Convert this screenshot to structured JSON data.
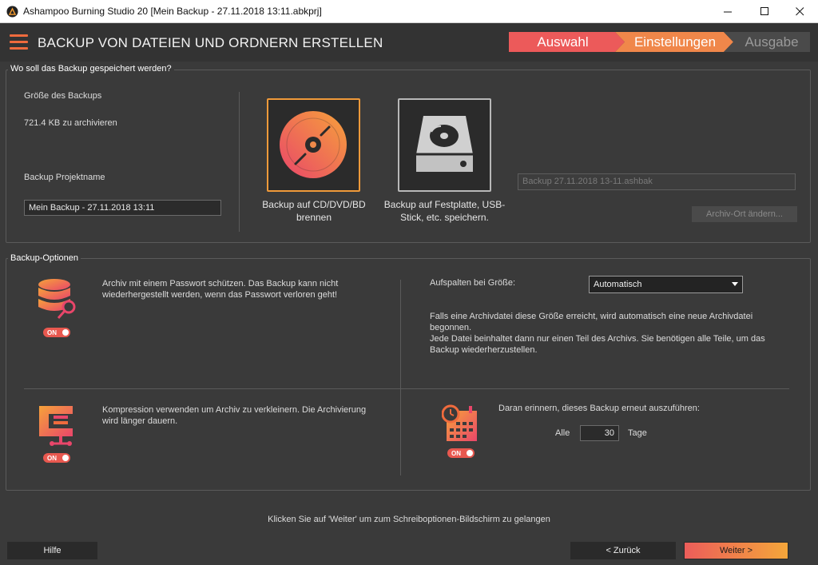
{
  "window": {
    "title": "Ashampoo Burning Studio 20 [Mein Backup - 27.11.2018 13:11.abkprj]"
  },
  "header": {
    "title": "BACKUP VON DATEIEN UND ORDNERN ERSTELLEN",
    "steps": [
      {
        "label": "Auswahl",
        "color": "#ec5a5a"
      },
      {
        "label": "Einstellungen",
        "color": "#f08a4a"
      },
      {
        "label": "Ausgabe",
        "color": "#4a4a4a"
      }
    ]
  },
  "save_section": {
    "group_label": "Wo soll das Backup gespeichert werden?",
    "size_label": "Größe des Backups",
    "size_value": "721.4 KB zu archivieren",
    "project_name_label": "Backup Projektname",
    "project_name_value": "Mein Backup - 27.11.2018 13:11",
    "target_cd_label": "Backup auf CD/DVD/BD brennen",
    "target_hdd_label": "Backup auf Festplatte, USB-Stick, etc. speichern.",
    "archive_path_value": "Backup 27.11.2018 13-11.ashbak",
    "change_location_button": "Archiv-Ort ändern..."
  },
  "options_section": {
    "group_label": "Backup-Optionen",
    "password_text": "Archiv mit einem Passwort schützen. Das Backup kann nicht wiederhergestellt werden, wenn das Passwort verloren geht!",
    "password_toggle": "ON",
    "split_label": "Aufspalten bei Größe:",
    "split_selected": "Automatisch",
    "split_info": "Falls eine Archivdatei diese Größe erreicht, wird automatisch eine neue Archivdatei begonnen.\nJede Datei beinhaltet dann nur einen Teil des Archivs. Sie benötigen alle Teile, um das Backup wiederherzustellen.",
    "compression_text": "Kompression verwenden um Archiv zu verkleinern. Die Archivierung wird länger dauern.",
    "compression_toggle": "ON",
    "reminder_text": "Daran erinnern, dieses Backup erneut auszuführen:",
    "reminder_every": "Alle",
    "reminder_days_value": "30",
    "reminder_days_unit": "Tage",
    "reminder_toggle": "ON"
  },
  "footer": {
    "hint": "Klicken Sie auf 'Weiter' um zum Schreiboptionen-Bildschirm zu gelangen",
    "help_button": "Hilfe",
    "back_button": "< Zurück",
    "next_button": "Weiter >"
  }
}
